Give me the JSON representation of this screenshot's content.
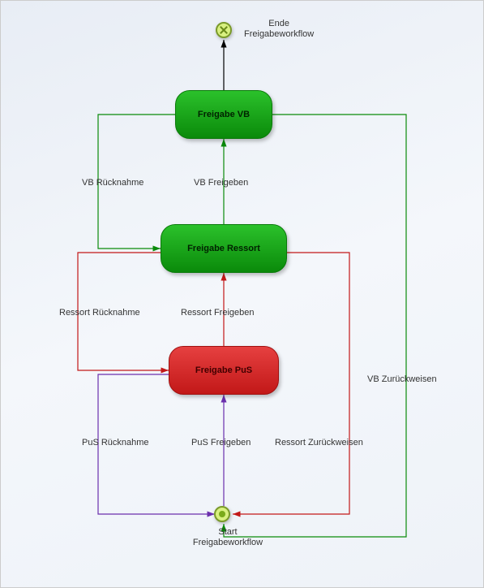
{
  "nodes": {
    "freigabe_vb": {
      "label": "Freigabe VB"
    },
    "freigabe_ressort": {
      "label": "Freigabe Ressort"
    },
    "freigabe_pus": {
      "label": "Freigabe PuS"
    }
  },
  "labels": {
    "end": "Ende\nFreigabeworkflow",
    "start": "Start\nFreigabeworkflow",
    "vb_ruecknahme": "VB Rücknahme",
    "vb_freigeben": "VB Freigeben",
    "ressort_ruecknahme": "Ressort Rücknahme",
    "ressort_freigeben": "Ressort Freigeben",
    "pus_ruecknahme": "PuS Rücknahme",
    "pus_freigeben": "PuS Freigeben",
    "vb_zurueckweisen": "VB Zurückweisen",
    "ressort_zurueckweisen": "Ressort Zurückweisen"
  }
}
